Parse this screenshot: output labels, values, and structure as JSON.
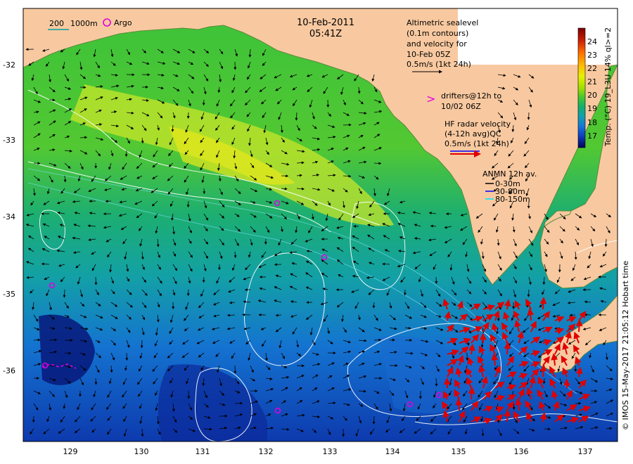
{
  "header": {
    "date": "10-Feb-2011",
    "time": "05:41Z"
  },
  "scale_bar": {
    "left": "200",
    "right": "1000m"
  },
  "argo_legend": "Argo",
  "altimetry_legend": [
    "Altimetric sealevel",
    "(0.1m contours)",
    "and velocity for",
    "10-Feb 05Z",
    "0.5m/s (1kt 24h)"
  ],
  "drifter_legend": [
    ">",
    "drifters@12h to",
    "10/02 06Z"
  ],
  "hf_radar_legend": [
    "HF radar velocity",
    "(4-12h avg)QC",
    "0.5m/s (1kt 24h)"
  ],
  "anmn_legend": {
    "title": "ANMN 12h av.",
    "items": [
      "0-30m",
      "30-80m",
      "80-150m"
    ],
    "colors": [
      "#000000",
      "#0000ff",
      "#00e5ff"
    ]
  },
  "colorbar": {
    "title": "Temp. (°C) 19_L3U 14% ql>=2",
    "ticks": [
      "24",
      "23",
      "22",
      "21",
      "20",
      "19",
      "18",
      "17"
    ],
    "colors": [
      "#7a0000",
      "#c81e00",
      "#ff6a00",
      "#ffb400",
      "#e8f000",
      "#a0e000",
      "#40c830",
      "#10b070",
      "#10a0b0",
      "#1478d8",
      "#1040c0",
      "#0a1a8c",
      "#05005a"
    ]
  },
  "credit": "© IMOS 15-May-2017 21:05:12 Hobart time",
  "axes": {
    "x_ticks": [
      "129",
      "130",
      "131",
      "132",
      "133",
      "134",
      "135",
      "136",
      "137"
    ],
    "y_ticks": [
      "-32",
      "-33",
      "-34",
      "-35",
      "-36"
    ]
  },
  "map_colors": {
    "land": "#f8c9a0",
    "legend_box": "#ffffff",
    "hf_arrow": "#e00000",
    "argo": "#e000e0",
    "contour": "#ffffff"
  },
  "icons": [
    "argo-circle-icon",
    "velocity-arrow-icon",
    "hf-radar-arrow-icon"
  ]
}
